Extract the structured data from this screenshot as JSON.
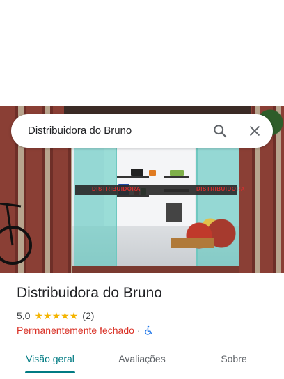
{
  "search": {
    "query": "Distribuidora do Bruno",
    "search_icon": "search-icon",
    "close_icon": "close-icon"
  },
  "photo": {
    "description_icon": "storefront-photo",
    "sign_text_left": "DISTRIBUIDORA",
    "sign_text_right": "DISTRIBUIDORA"
  },
  "place": {
    "name": "Distribuidora do Bruno",
    "rating": "5,0",
    "stars": 5,
    "review_count": "(2)",
    "status": "Permanentemente fechado",
    "separator": "·",
    "accessibility_icon": "wheelchair-icon"
  },
  "tabs": [
    {
      "label": "Visão geral",
      "active": true
    },
    {
      "label": "Avaliações",
      "active": false
    },
    {
      "label": "Sobre",
      "active": false
    }
  ],
  "colors": {
    "accent": "#007b83",
    "star": "#f4b400",
    "closed": "#d93025",
    "accessibility": "#1a73e8"
  }
}
